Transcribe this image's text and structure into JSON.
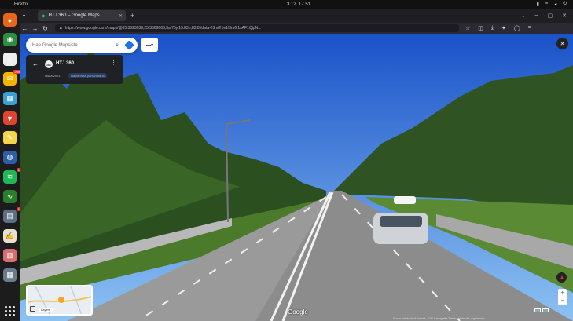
{
  "os": {
    "app_name": "Firefox",
    "clock": "3.12.   17.51"
  },
  "dock": {
    "items": [
      {
        "name": "firefox-icon",
        "color": "#e8651a",
        "glyph": "●"
      },
      {
        "name": "chrome-icon",
        "color": "#2a8f3f",
        "glyph": "◉"
      },
      {
        "name": "files-icon",
        "color": "#eeeeee",
        "glyph": "▯"
      },
      {
        "name": "mail-icon",
        "color": "#f5b400",
        "glyph": "✉",
        "badge": "269"
      },
      {
        "name": "photos-icon",
        "color": "#3aa0d0",
        "glyph": "▦"
      },
      {
        "name": "brave-icon",
        "color": "#e0452f",
        "glyph": "▼"
      },
      {
        "name": "notes-icon",
        "color": "#f3d54a",
        "glyph": "✎"
      },
      {
        "name": "vpn-icon",
        "color": "#2d5fa8",
        "glyph": "◍"
      },
      {
        "name": "spotify-icon",
        "color": "#1db954",
        "glyph": "≋",
        "badge": "1"
      },
      {
        "name": "monitor-icon",
        "color": "#2a7d2a",
        "glyph": "∿"
      },
      {
        "name": "archive-icon",
        "color": "#5c6f86",
        "glyph": "▤",
        "badge": "1"
      },
      {
        "name": "text-editor-icon",
        "color": "#e7e1cf",
        "glyph": "✍"
      },
      {
        "name": "document-icon",
        "color": "#d86e6e",
        "glyph": "▥"
      },
      {
        "name": "calculator-icon",
        "color": "#6a7b8c",
        "glyph": "▦"
      }
    ]
  },
  "browser": {
    "tab_title": "HTJ 360 – Google Maps",
    "url": "https://www.google.com/maps/@65.3823039,25.3569663,3a,75y,15.83h,83.8t/data=!3m8!1e1!3m6!1sAF1QipN..."
  },
  "maps": {
    "search_placeholder": "Hae Google Mapsista",
    "place_name": "HTJ 360",
    "place_date": "Issaa 2021",
    "place_link": "Näytä lisää päivämääriä",
    "minimap_label": "Layers",
    "google_logo": "Google",
    "attribution": "Kuvan päivämäärä: heinäk. 2021   Kartografia  Tietosuoja  Ilmoita ongelmasta"
  },
  "colors": {
    "sky_top": "#1a52c9",
    "sky_bottom": "#7fb8f0",
    "road": "#8c8c8c",
    "grass": "#4b7a2a",
    "forest": "#2c4f1f"
  }
}
